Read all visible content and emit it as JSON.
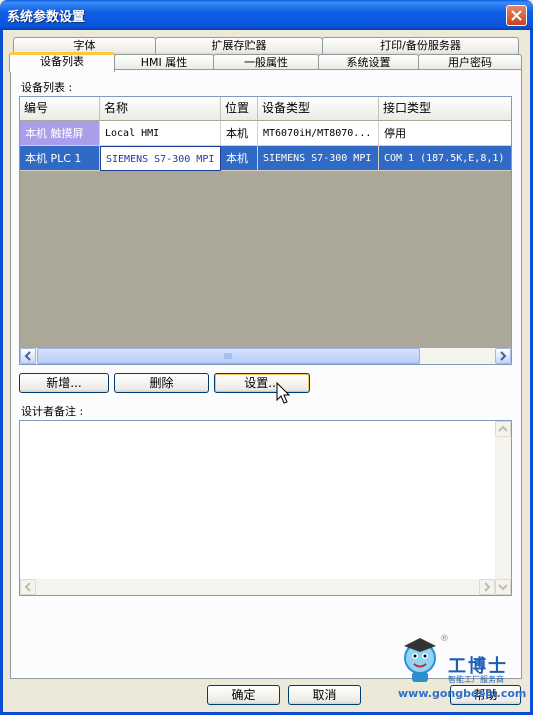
{
  "window": {
    "title": "系统参数设置"
  },
  "tabs_back": [
    "字体",
    "扩展存贮器",
    "打印/备份服务器"
  ],
  "tabs_front": [
    "设备列表",
    "HMI 属性",
    "一般属性",
    "系统设置",
    "用户密码"
  ],
  "device_list": {
    "label": "设备列表 :",
    "columns": [
      "编号",
      "名称",
      "位置",
      "设备类型",
      "接口类型"
    ],
    "rows": [
      [
        "本机 触摸屏",
        "Local HMI",
        "本机",
        "MT6070iH/MT8070...",
        "停用"
      ],
      [
        "本机 PLC 1",
        "SIEMENS S7-300 MPI",
        "本机",
        "SIEMENS S7-300 MPI",
        "COM 1 (187.5K,E,8,1)"
      ]
    ],
    "selected_row": 1
  },
  "actions": {
    "add": "新增...",
    "delete": "删除",
    "settings": "设置..."
  },
  "notes": {
    "label": "设计者备注 :",
    "value": ""
  },
  "footer": {
    "ok": "确定",
    "cancel": "取消",
    "help": "帮助"
  },
  "watermark": {
    "brand": "工博士",
    "sub": "智能工厂服务商",
    "url": "www.gongboshi.com",
    "reg": "®"
  },
  "colors": {
    "accent": "#316ac5",
    "titlebar": "#0a54d8",
    "tab_highlight": "#ffc83c",
    "rowhead": "#a99ee9"
  },
  "icons": [
    "close-icon",
    "scroll-left-icon",
    "scroll-right-icon",
    "scroll-up-icon",
    "scroll-down-icon",
    "mouse-cursor-icon",
    "mascot-icon"
  ]
}
